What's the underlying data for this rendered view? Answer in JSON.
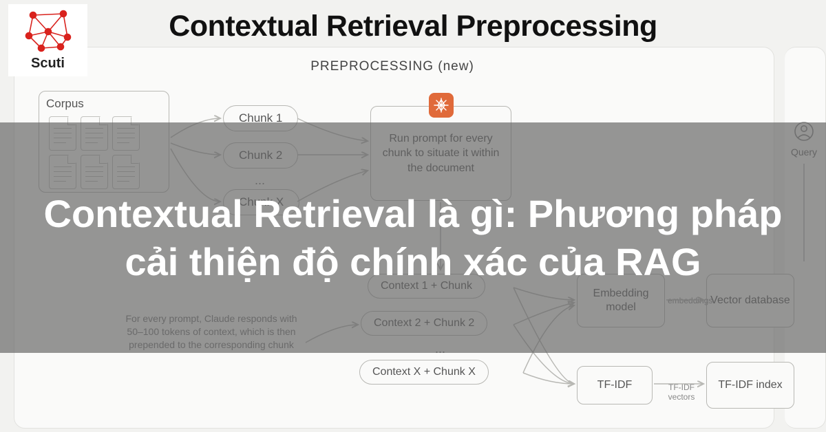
{
  "logo": {
    "name": "Scuti"
  },
  "title": "Contextual Retrieval Preprocessing",
  "section_label": "PREPROCESSING",
  "section_label_suffix": "(new)",
  "corpus": {
    "label": "Corpus"
  },
  "chunks": {
    "c1": "Chunk 1",
    "c2": "Chunk 2",
    "cx": "Chunk X"
  },
  "ellipsis": "...",
  "prompt_box": "Run prompt for every chunk to situate it within the document",
  "contexts": {
    "c1": "Context 1 + Chunk",
    "c2": "Context 2 + Chunk 2",
    "cx": "Context X + Chunk X"
  },
  "note": "For every prompt, Claude responds with 50–100 tokens of context, which is then prepended to the corresponding chunk",
  "embedding": {
    "label": "Embedding model",
    "edge": "embeddings"
  },
  "vector_db": "Vector database",
  "tfidf": {
    "label": "TF-IDF",
    "edge": "TF-IDF vectors",
    "index": "TF-IDF index"
  },
  "query": "Query",
  "overlay": "Contextual Retrieval là gì: Phương pháp cải thiện độ chính xác của RAG"
}
